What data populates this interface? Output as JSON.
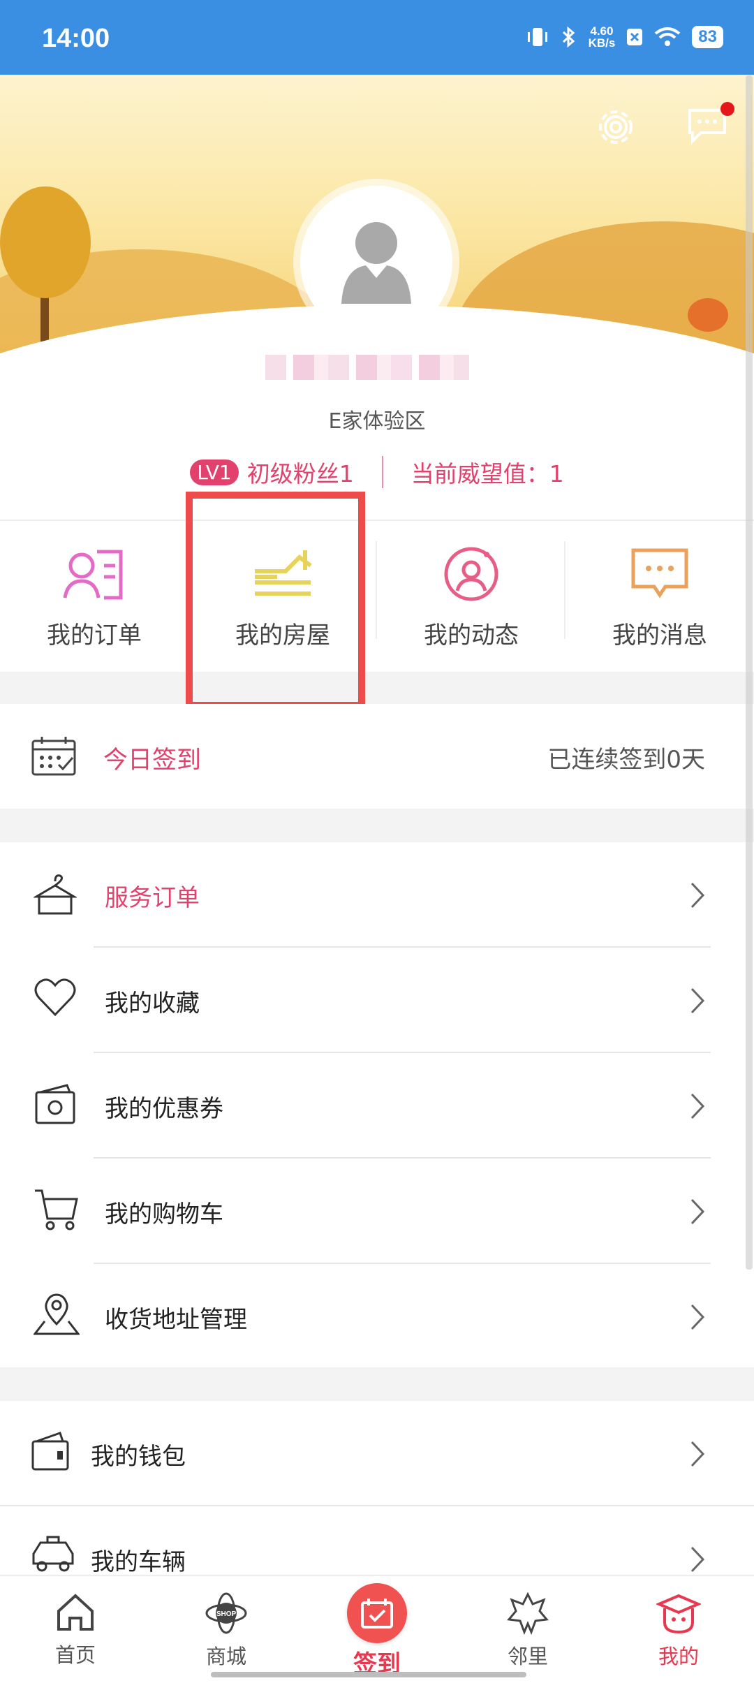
{
  "status_bar": {
    "time": "14:00",
    "net_speed_value": "4.60",
    "net_speed_unit": "KB/s",
    "battery": "83"
  },
  "profile": {
    "community": "E家体验区",
    "level_badge": "LV1",
    "level_name": "初级粉丝1",
    "prestige": "当前威望值：1"
  },
  "quick_actions": [
    {
      "label": "我的订单",
      "icon": "order-person-icon"
    },
    {
      "label": "我的房屋",
      "icon": "house-icon"
    },
    {
      "label": "我的动态",
      "icon": "activity-person-icon"
    },
    {
      "label": "我的消息",
      "icon": "message-bubble-icon"
    }
  ],
  "checkin": {
    "title": "今日签到",
    "status": "已连续签到0天"
  },
  "menu": [
    {
      "label": "服务订单",
      "icon": "hanger-icon",
      "highlight": true
    },
    {
      "label": "我的收藏",
      "icon": "heart-icon"
    },
    {
      "label": "我的优惠券",
      "icon": "coupon-icon"
    },
    {
      "label": "我的购物车",
      "icon": "cart-icon"
    },
    {
      "label": "收货地址管理",
      "icon": "location-pin-icon"
    }
  ],
  "menu2": [
    {
      "label": "我的钱包",
      "icon": "wallet-icon"
    },
    {
      "label": "我的车辆",
      "icon": "car-icon"
    }
  ],
  "tabs": [
    {
      "label": "首页",
      "icon": "home-icon"
    },
    {
      "label": "商城",
      "icon": "shop-icon",
      "icon_text": "SHOP"
    },
    {
      "label": "签到",
      "icon": "checkin-icon"
    },
    {
      "label": "邻里",
      "icon": "neighbor-icon"
    },
    {
      "label": "我的",
      "icon": "profile-icon"
    }
  ],
  "colors": {
    "accent": "#e2416d",
    "status_bar": "#3b8fe2",
    "checkin_red": "#f05151",
    "house_icon": "#e8d35a",
    "highlight_box": "#ee4b4b"
  }
}
